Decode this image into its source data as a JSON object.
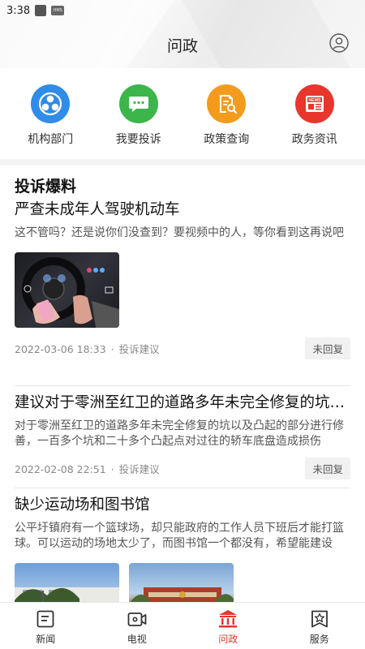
{
  "status_bar": {
    "time": "3:38",
    "hms_text": "HMS"
  },
  "header": {
    "title": "问政"
  },
  "quick_actions": [
    {
      "label": "机构部门",
      "icon": "org-icon",
      "color": "#2f8ce8"
    },
    {
      "label": "我要投诉",
      "icon": "chat-icon",
      "color": "#3cb54a"
    },
    {
      "label": "政策查询",
      "icon": "policy-search-icon",
      "color": "#f29b1d"
    },
    {
      "label": "政务资讯",
      "icon": "news-icon",
      "color": "#e8362d",
      "icon_text": "NEWS"
    }
  ],
  "section": {
    "title": "投诉爆料"
  },
  "posts": [
    {
      "title": "严查未成年人驾驶机动车",
      "desc": "这不管吗？还是说你们没查到？要视频中的人，等你看到这再说吧",
      "date": "2022-03-06 18:33",
      "category": "投诉建议",
      "status": "未回复"
    },
    {
      "title": "建议对于零洲至红卫的道路多年未完全修复的坑以及凸起的部分进行修善",
      "desc": "对于零洲至红卫的道路多年未完全修复的坑以及凸起的部分进行修善，一百多个坑和二十多个凸起点对过往的轿车底盘造成损伤",
      "date": "2022-02-08 22:51",
      "category": "投诉建议",
      "status": "未回复"
    },
    {
      "title": "缺少运动场和图书馆",
      "desc": "公平圩镇府有一个篮球场，却只能政府的工作人员下班后才能打篮球。可以运动的场地太少了，而图书馆一个都没有，希望能建设"
    }
  ],
  "tabbar": [
    {
      "label": "新闻",
      "icon": "news-tab-icon",
      "active": false
    },
    {
      "label": "电视",
      "icon": "tv-icon",
      "active": false
    },
    {
      "label": "问政",
      "icon": "government-building-icon",
      "active": true
    },
    {
      "label": "服务",
      "icon": "service-star-icon",
      "active": false
    }
  ],
  "colors": {
    "accent": "#e8362d",
    "text": "#111111",
    "muted": "#888888"
  }
}
